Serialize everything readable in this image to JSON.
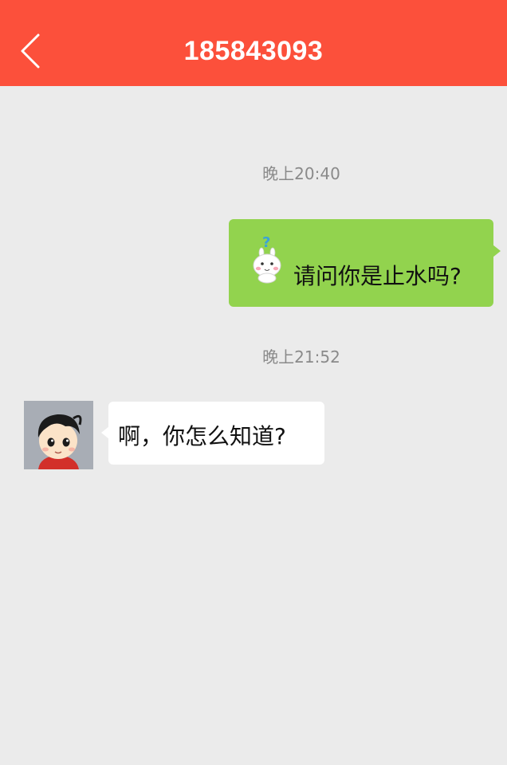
{
  "header": {
    "title": "185843093",
    "back_icon": "chevron-left-icon",
    "background_color": "#fc503b"
  },
  "messages": [
    {
      "time": "晚上20:40",
      "direction": "outgoing",
      "sticker_icon": "confused-bunny-sticker-icon",
      "sticker_glyph": "?",
      "text": "请问你是止水吗?",
      "bubble_color": "#92d34e"
    },
    {
      "time": "晚上21:52",
      "direction": "incoming",
      "avatar_icon": "cartoon-boy-avatar-icon",
      "text": "啊，你怎么知道?",
      "bubble_color": "#ffffff"
    }
  ]
}
